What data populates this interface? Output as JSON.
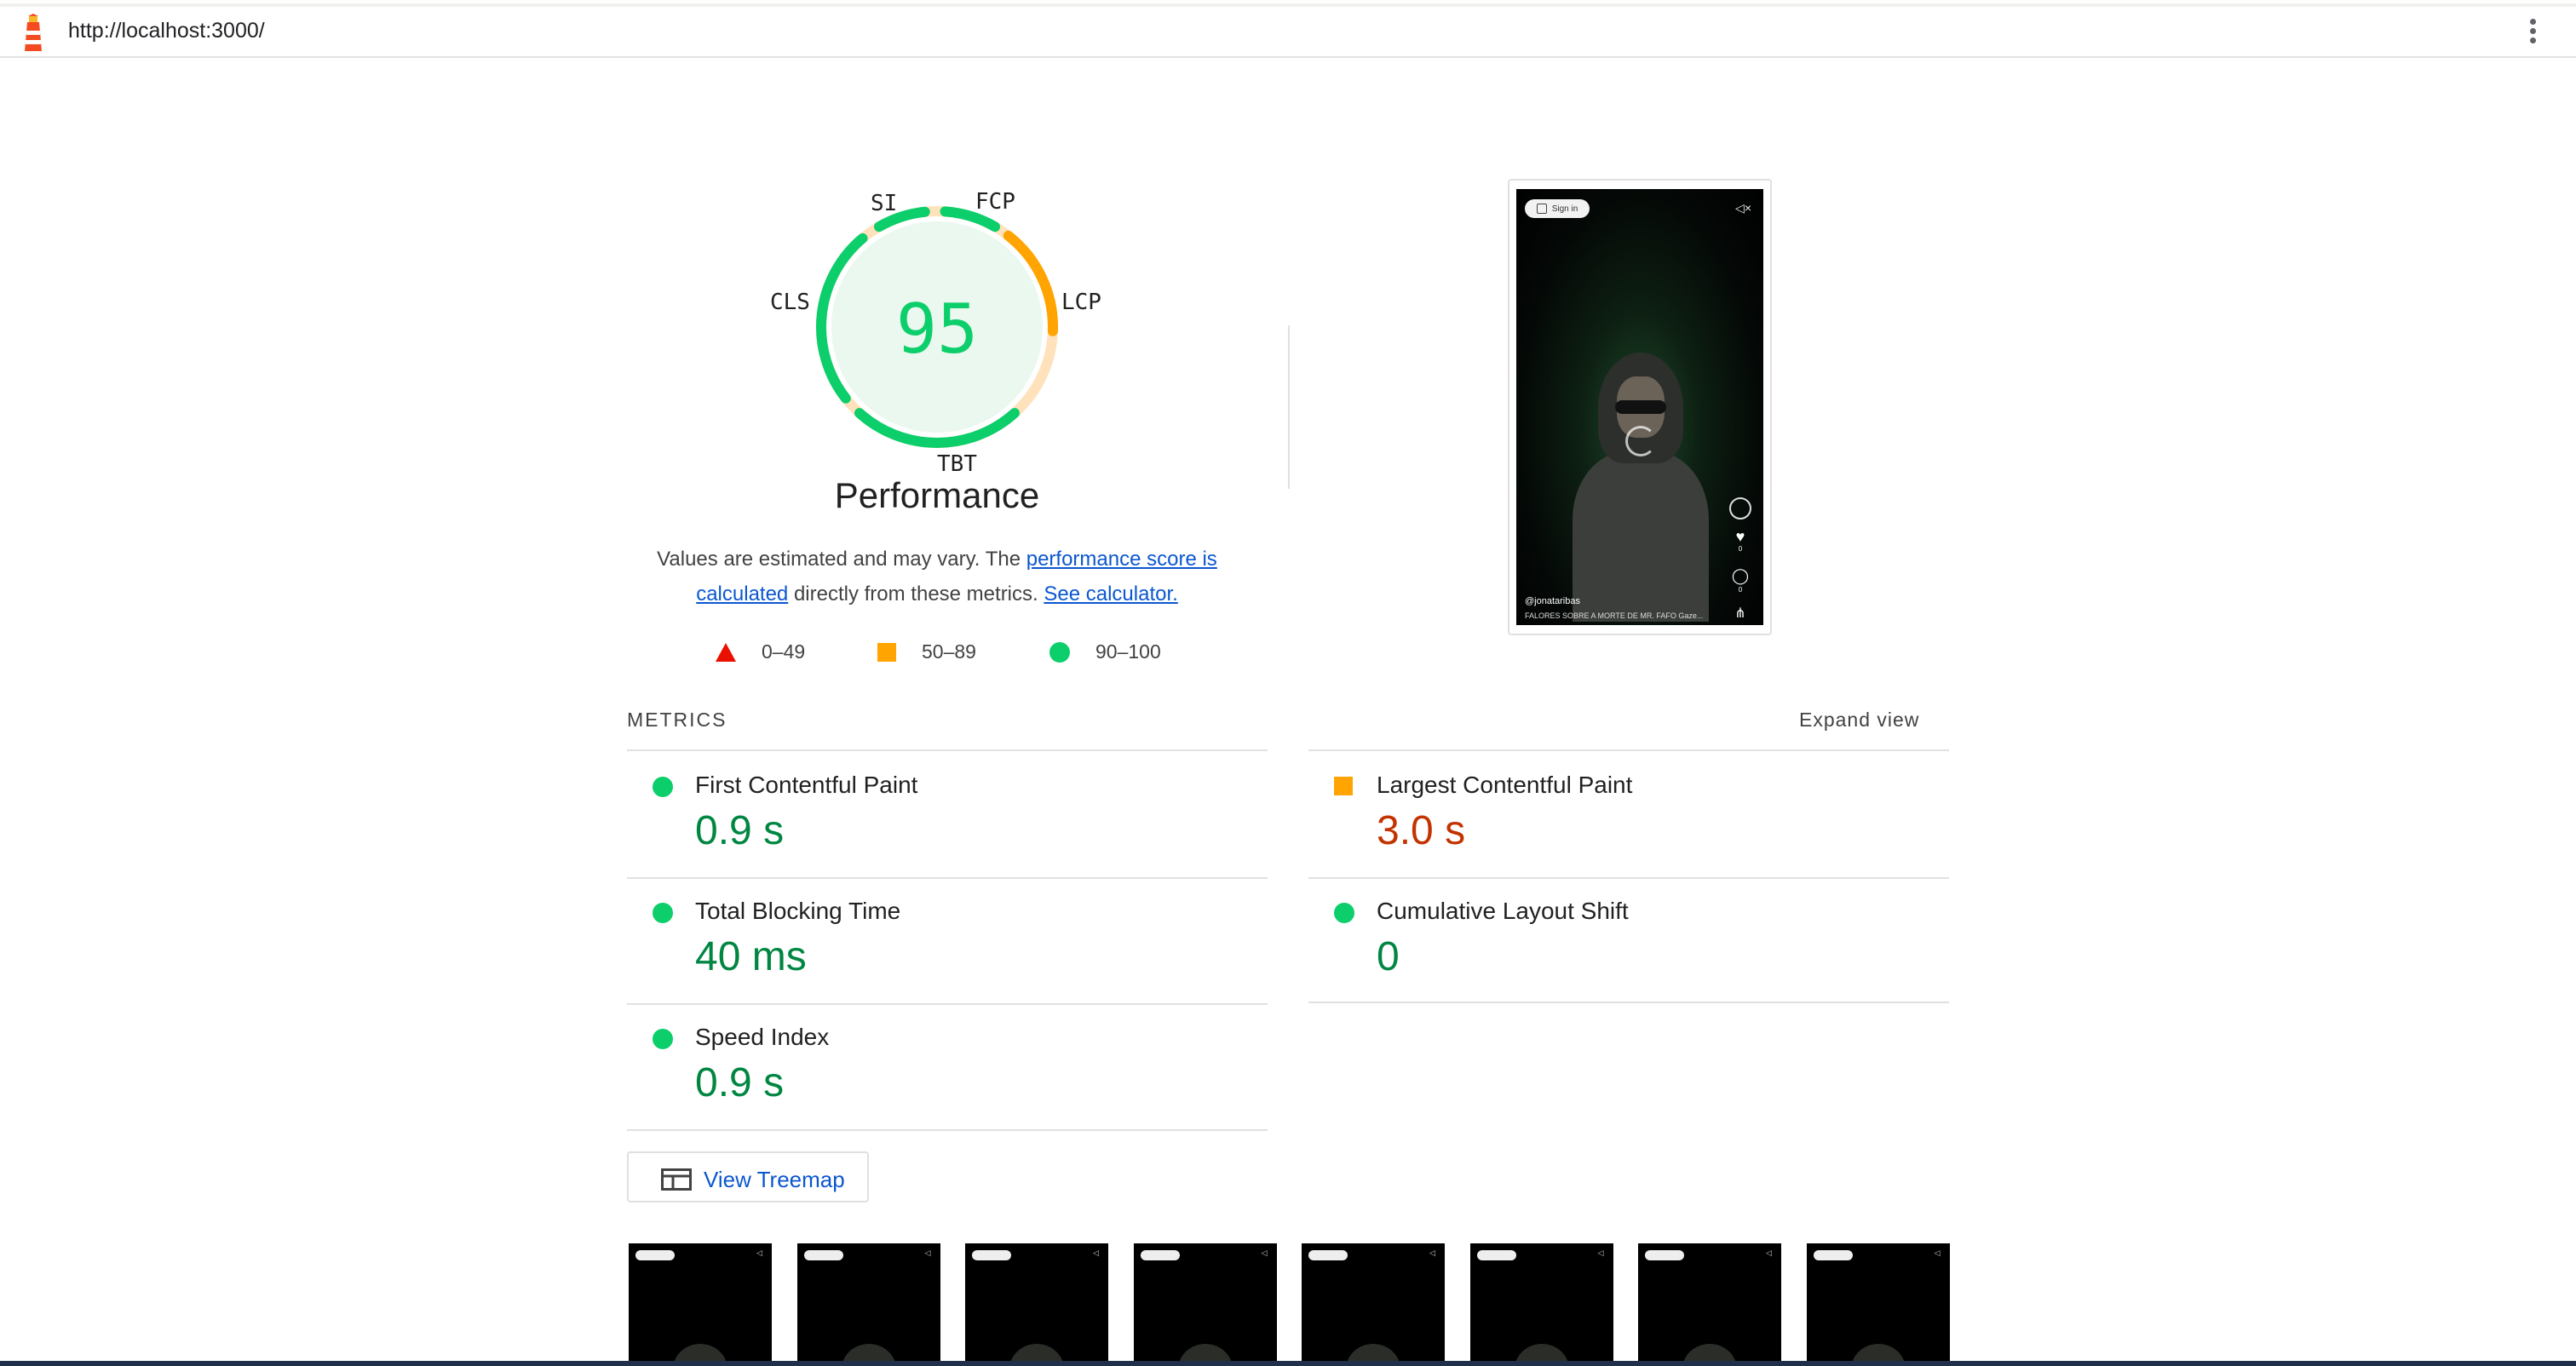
{
  "browser": {
    "url": "http://localhost:3000/"
  },
  "gauge": {
    "score": "95",
    "title": "Performance",
    "labels": {
      "si": "SI",
      "fcp": "FCP",
      "lcp": "LCP",
      "tbt": "TBT",
      "cls": "CLS"
    }
  },
  "description": {
    "prefix": "Values are estimated and may vary. The ",
    "link1": "performance score is calculated",
    "middle": " directly from these metrics. ",
    "link2": "See calculator."
  },
  "legend": [
    {
      "label": "0–49",
      "shape": "triangle",
      "color": "#eb0f00"
    },
    {
      "label": "50–89",
      "shape": "square",
      "color": "#ffa400"
    },
    {
      "label": "90–100",
      "shape": "circle",
      "color": "#0cce6b"
    }
  ],
  "screenshot": {
    "signin_label": "Sign in",
    "author": "@jonataribas",
    "caption": "FALORES SOBRE A MORTE DE MR. FAFO Gaze...",
    "like_count": "0",
    "comment_count": "0"
  },
  "metrics": {
    "header": "METRICS",
    "expand": "Expand view",
    "items": [
      {
        "name": "First Contentful Paint",
        "value": "0.9 s",
        "rating": "good"
      },
      {
        "name": "Largest Contentful Paint",
        "value": "3.0 s",
        "rating": "average"
      },
      {
        "name": "Total Blocking Time",
        "value": "40 ms",
        "rating": "good"
      },
      {
        "name": "Cumulative Layout Shift",
        "value": "0",
        "rating": "good"
      },
      {
        "name": "Speed Index",
        "value": "0.9 s",
        "rating": "good"
      }
    ]
  },
  "treemap": {
    "label": "View Treemap"
  },
  "colors": {
    "good": "#0cce6b",
    "good_text": "#018642",
    "average": "#ffa400",
    "average_text": "#c33300",
    "poor": "#eb0f00",
    "link": "#0b57d0"
  }
}
